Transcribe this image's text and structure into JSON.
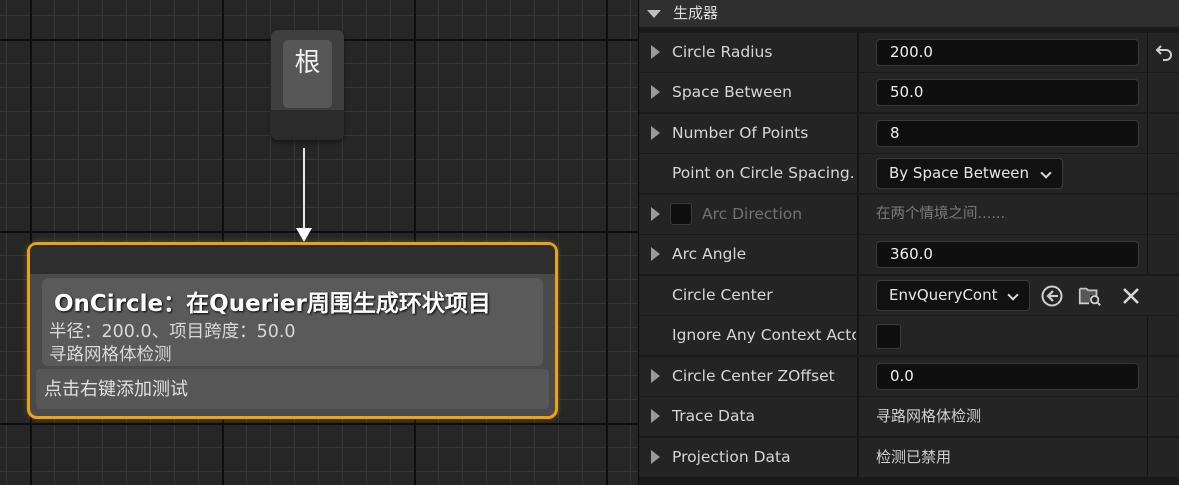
{
  "graph": {
    "root_node": {
      "label": "根"
    },
    "oncircle_node": {
      "title": "OnCircle：在Querier周围生成环状项目",
      "detail_line1": "半径：200.0、项目跨度：50.0",
      "detail_line2": "寻路网格体检测",
      "tests_hint": "点击右键添加测试"
    }
  },
  "details": {
    "category": "生成器",
    "properties": {
      "circle_radius": {
        "name": "Circle Radius",
        "value": "200.0"
      },
      "space_between": {
        "name": "Space Between",
        "value": "50.0"
      },
      "number_of_points": {
        "name": "Number Of Points",
        "value": "8"
      },
      "point_spacing": {
        "name": "Point on Circle Spacing...",
        "value": "By Space Between"
      },
      "arc_direction": {
        "name": "Arc Direction",
        "value": "在两个情境之间......"
      },
      "arc_angle": {
        "name": "Arc Angle",
        "value": "360.0"
      },
      "circle_center": {
        "name": "Circle Center",
        "value": "EnvQueryCont"
      },
      "ignore_context": {
        "name": "Ignore Any Context Acto..."
      },
      "circle_center_zoffset": {
        "name": "Circle Center ZOffset",
        "value": "0.0"
      },
      "trace_data": {
        "name": "Trace Data",
        "value": "寻路网格体检测"
      },
      "projection_data": {
        "name": "Projection Data",
        "value": "检测已禁用"
      }
    }
  },
  "icons": {
    "expander": "triangle-right-icon",
    "category_chevron": "triangle-down-icon",
    "reset": "reset-to-default-icon",
    "use_selected": "arrow-left-circle-icon",
    "browse": "folder-search-icon",
    "clear": "close-icon"
  },
  "colors": {
    "selected_node_border": "#e8a317",
    "panel_bg": "#242424",
    "input_bg": "#0f0f0f"
  }
}
